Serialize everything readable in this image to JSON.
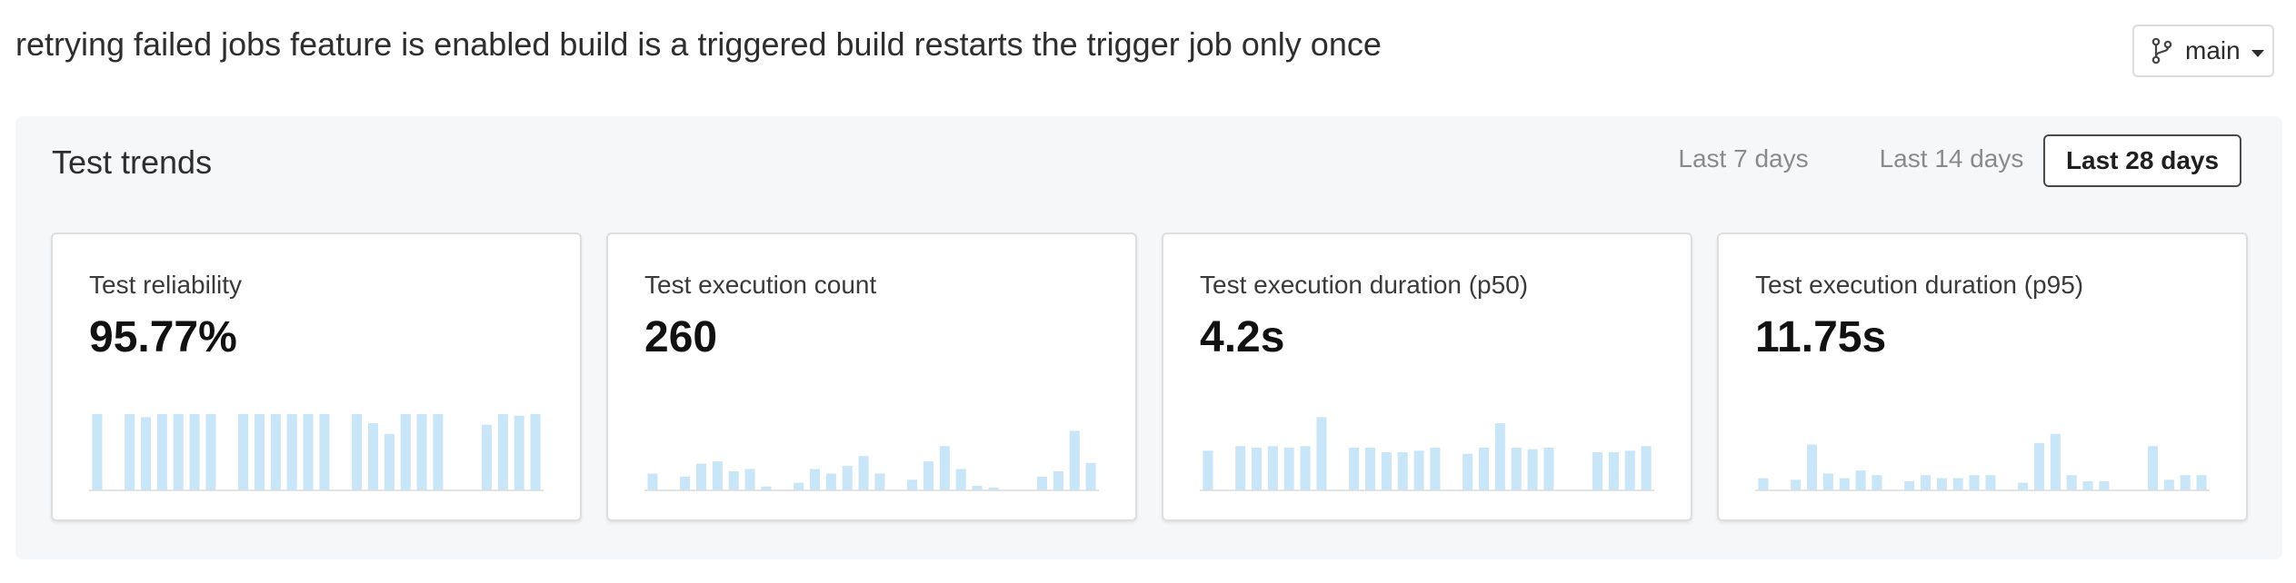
{
  "header": {
    "title": "retrying failed jobs feature is enabled build is a triggered build restarts the trigger job only once",
    "branch_label": "main",
    "branch_icon": "git-branch-icon"
  },
  "trends": {
    "title": "Test trends",
    "ranges": [
      "Last 7 days",
      "Last 14 days",
      "Last 28 days"
    ],
    "selected_range": "Last 28 days"
  },
  "colors": {
    "bar": "#c8e6f8",
    "axis": "#dcdcdc",
    "selected_border": "#4a4a4a"
  },
  "cards": [
    {
      "label": "Test reliability",
      "value": "95.77%",
      "bars": [
        1.0,
        0,
        1.0,
        0.96,
        1.0,
        1.0,
        1.0,
        1.0,
        0,
        1.0,
        1.0,
        1.0,
        1.0,
        1.0,
        1.0,
        0,
        1.0,
        0.88,
        0.74,
        1.0,
        1.0,
        1.0,
        0,
        0,
        0.86,
        1.0,
        0.98,
        1.0
      ]
    },
    {
      "label": "Test execution count",
      "value": "260",
      "bars": [
        0.22,
        0,
        0.18,
        0.35,
        0.38,
        0.25,
        0.28,
        0.05,
        0,
        0.1,
        0.28,
        0.22,
        0.32,
        0.45,
        0.22,
        0,
        0.14,
        0.38,
        0.58,
        0.28,
        0.06,
        0.03,
        0,
        0,
        0.18,
        0.25,
        0.78,
        0.36
      ]
    },
    {
      "label": "Test execution duration (p50)",
      "value": "4.2s",
      "bars": [
        0.52,
        0,
        0.58,
        0.56,
        0.58,
        0.56,
        0.58,
        0.96,
        0,
        0.56,
        0.56,
        0.5,
        0.5,
        0.52,
        0.56,
        0,
        0.48,
        0.56,
        0.88,
        0.56,
        0.54,
        0.56,
        0,
        0,
        0.5,
        0.5,
        0.52,
        0.58
      ]
    },
    {
      "label": "Test execution duration (p95)",
      "value": "11.75s",
      "bars": [
        0.16,
        0,
        0.14,
        0.6,
        0.22,
        0.16,
        0.26,
        0.2,
        0,
        0.12,
        0.2,
        0.16,
        0.16,
        0.2,
        0.2,
        0,
        0.1,
        0.62,
        0.74,
        0.2,
        0.12,
        0.12,
        0,
        0,
        0.58,
        0.14,
        0.2,
        0.2
      ]
    }
  ]
}
